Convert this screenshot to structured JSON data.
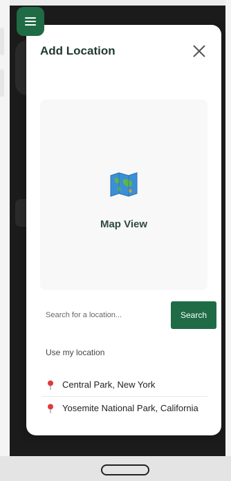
{
  "modal": {
    "title": "Add Location",
    "close_icon": "close-icon",
    "map": {
      "icon": "world-map-icon",
      "label": "Map View"
    },
    "search": {
      "placeholder": "Search for a location...",
      "button_label": "Search"
    },
    "use_my_location": "Use my location",
    "locations": [
      {
        "name": "Central Park, New York",
        "icon": "pin-icon"
      },
      {
        "name": "Yosemite National Park, California",
        "icon": "pin-icon"
      }
    ]
  },
  "menu_button": {
    "icon": "hamburger-menu-icon"
  },
  "system_nav": {
    "home": "home-pill"
  },
  "colors": {
    "accent": "#1f6b46",
    "title": "#1f3a30",
    "pin": "#e03a3a"
  }
}
